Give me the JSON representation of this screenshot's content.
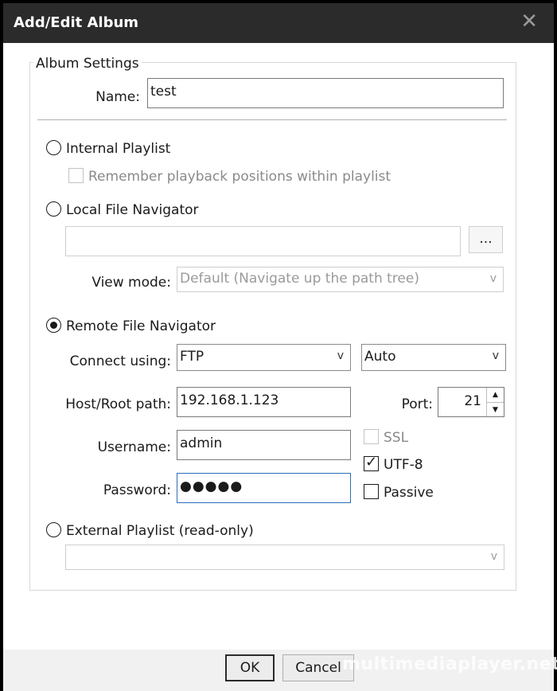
{
  "window": {
    "title": "Add/Edit Album",
    "close_glyph": "✕"
  },
  "album_settings": {
    "legend": "Album Settings",
    "name_label": "Name:",
    "name_value": "test"
  },
  "internal_playlist": {
    "label": "Internal Playlist",
    "selected": false,
    "remember_label": "Remember playback positions within playlist",
    "remember_checked": false
  },
  "local_file_navigator": {
    "label": "Local File Navigator",
    "selected": false,
    "path_value": "",
    "browse_label": "...",
    "view_mode_label": "View mode:",
    "view_mode_value": "Default (Navigate up the path tree)"
  },
  "remote_file_navigator": {
    "label": "Remote File Navigator",
    "selected": true,
    "connect_label": "Connect using:",
    "protocol_value": "FTP",
    "mode_value": "Auto",
    "host_label": "Host/Root path:",
    "host_value": "192.168.1.123",
    "port_label": "Port:",
    "port_value": "21",
    "username_label": "Username:",
    "username_value": "admin",
    "password_label": "Password:",
    "password_value": "●●●●●",
    "ssl_label": "SSL",
    "ssl_checked": false,
    "utf8_label": "UTF-8",
    "utf8_checked": true,
    "passive_label": "Passive",
    "passive_checked": false
  },
  "external_playlist": {
    "label": "External Playlist (read-only)",
    "selected": false,
    "value": ""
  },
  "buttons": {
    "ok": "OK",
    "cancel": "Cancel"
  },
  "icons": {
    "chevron": "v",
    "tick": "✓",
    "spin_up": "▲",
    "spin_down": "▼"
  },
  "watermark": "multimediaplayer.net"
}
